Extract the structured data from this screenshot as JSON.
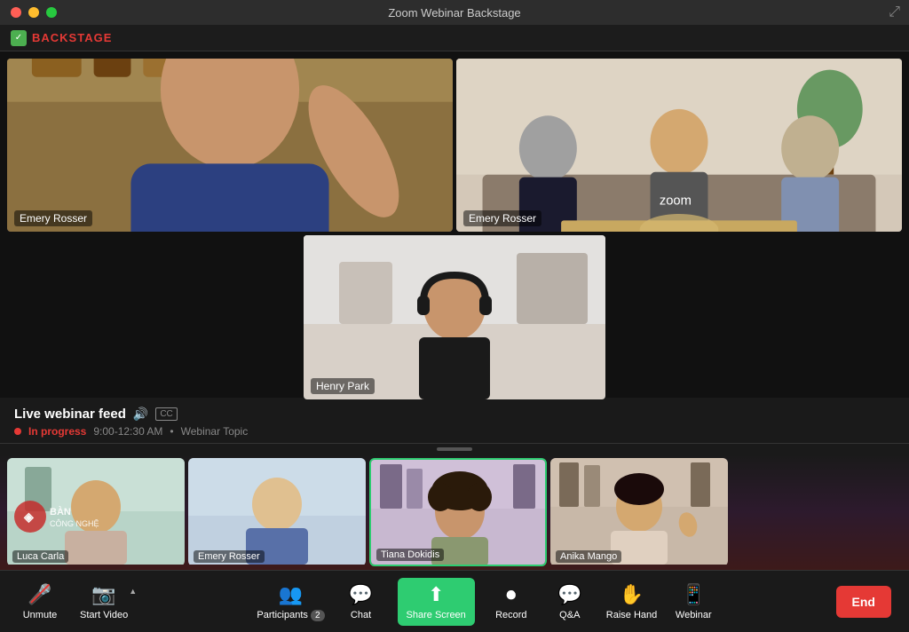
{
  "window": {
    "title": "Zoom Webinar  Backstage"
  },
  "backstage": {
    "label": "BACKSTAGE"
  },
  "video_cells": [
    {
      "id": "emery-rosser-1",
      "name": "Emery Rosser",
      "class": "vid-emery1"
    },
    {
      "id": "emery-rosser-2",
      "name": "Emery Rosser",
      "class": "vid-emery2"
    },
    {
      "id": "henry-park",
      "name": "Henry Park",
      "class": "vid-henry"
    }
  ],
  "info": {
    "feed_label": "Live webinar feed",
    "status": "In progress",
    "time": "9:00-12:30 AM",
    "topic": "Webinar Topic"
  },
  "participants": [
    {
      "id": "p1",
      "name": "Luca Carla",
      "class": "thumb-vid-1",
      "active": false
    },
    {
      "id": "p2",
      "name": "Emery Rosser",
      "class": "thumb-vid-2",
      "active": false
    },
    {
      "id": "p3",
      "name": "Tiana Dokidis",
      "class": "thumb-vid-3",
      "active": true
    },
    {
      "id": "p4",
      "name": "Anika Mango",
      "class": "thumb-vid-4",
      "active": false
    }
  ],
  "toolbar": {
    "unmute_label": "Unmute",
    "start_video_label": "Start Video",
    "participants_label": "Participants",
    "participants_count": "2",
    "chat_label": "Chat",
    "share_screen_label": "Share Screen",
    "record_label": "Record",
    "qa_label": "Q&A",
    "raise_hand_label": "Raise Hand",
    "webinar_label": "Webinar",
    "end_label": "End"
  },
  "colors": {
    "accent_green": "#2ecc71",
    "accent_red": "#e53935",
    "backstage_red": "#e53935",
    "text_white": "#ffffff",
    "bg_dark": "#1a1a1a"
  }
}
